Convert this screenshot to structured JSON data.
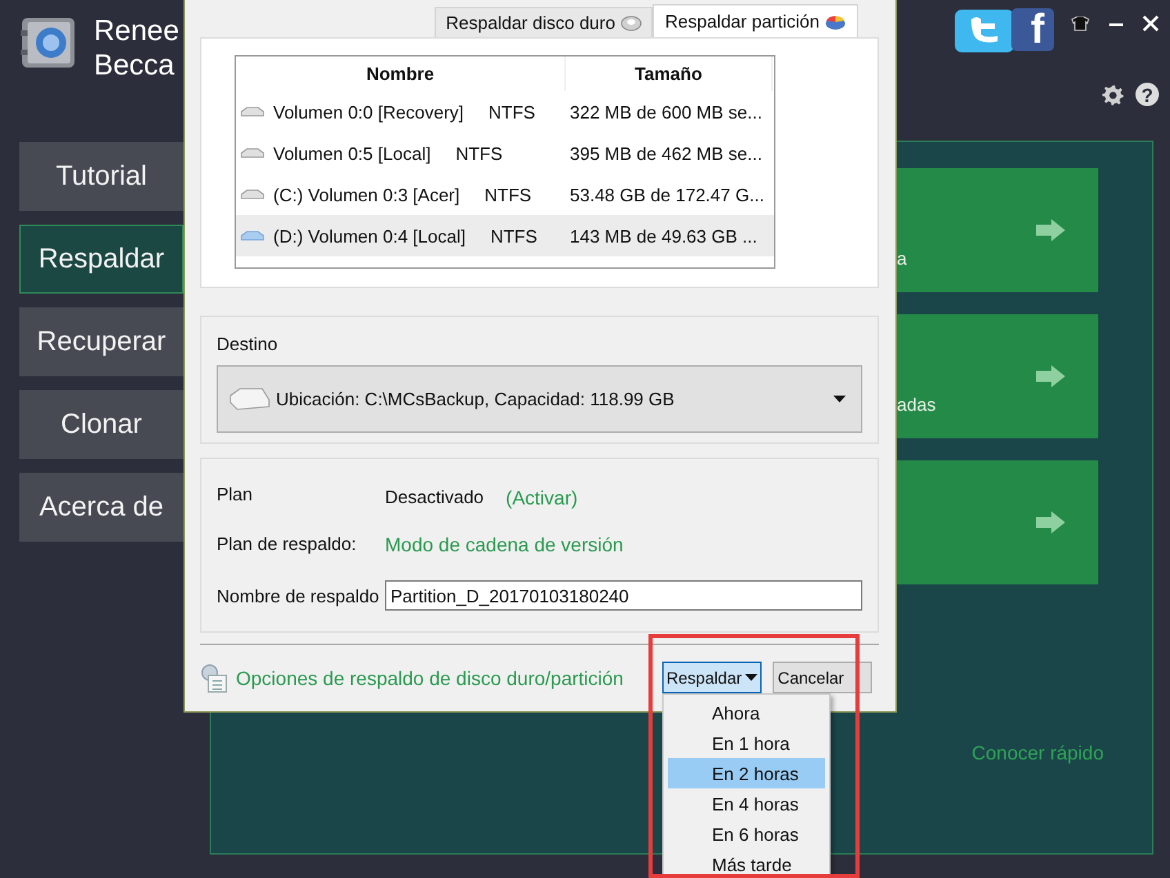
{
  "app": {
    "app_name": "Renee Becca",
    "social": {
      "facebook_glyph": "f"
    },
    "help_glyph": "?",
    "nav": [
      {
        "label": "Tutorial",
        "selected": false
      },
      {
        "label": "Respaldar",
        "selected": true
      },
      {
        "label": "Recuperar",
        "selected": false
      },
      {
        "label": "Clonar",
        "selected": false
      },
      {
        "label": "Acerca de",
        "selected": false
      }
    ],
    "card_captions": [
      "a",
      "adas"
    ],
    "quick_link": "Conocer rápido"
  },
  "dialog": {
    "tabs": [
      {
        "label": "Respaldar disco duro",
        "selected": false
      },
      {
        "label": "Respaldar partición",
        "selected": true
      }
    ],
    "table": {
      "columns": [
        "Nombre",
        "Tamaño"
      ],
      "rows": [
        {
          "name": "Volumen 0:0 [Recovery]",
          "file_system": "NTFS",
          "size": "322 MB de 600 MB se...",
          "selected": false
        },
        {
          "name": "Volumen 0:5 [Local]",
          "file_system": "NTFS",
          "size": "395 MB de 462 MB se...",
          "selected": false
        },
        {
          "name": "(C:) Volumen 0:3 [Acer]",
          "file_system": "NTFS",
          "size": "53.48 GB de 172.47 G...",
          "selected": false
        },
        {
          "name": "(D:) Volumen 0:4 [Local]",
          "file_system": "NTFS",
          "size": "143 MB de 49.63 GB ...",
          "selected": true
        }
      ]
    },
    "destination": {
      "label": "Destino",
      "value": "Ubicación: C:\\MCsBackup, Capacidad: 118.99 GB"
    },
    "plan": {
      "label": "Plan",
      "status": "Desactivado",
      "link": "(Activar)"
    },
    "scheme": {
      "label": "Plan de respaldo:",
      "value": "Modo de cadena de versión"
    },
    "backup_name": {
      "label": "Nombre de respaldo",
      "value": "Partition_D_20170103180240"
    },
    "options_link": "Opciones de respaldo de disco duro/partición",
    "buttons": [
      {
        "label": "Respaldar",
        "kind": "split"
      },
      {
        "label": "Cancelar",
        "kind": "plain"
      }
    ],
    "menu": [
      {
        "label": "Ahora",
        "selected": false
      },
      {
        "label": "En 1 hora",
        "selected": false
      },
      {
        "label": "En 2 horas",
        "selected": true
      },
      {
        "label": "En 4 horas",
        "selected": false
      },
      {
        "label": "En 6 horas",
        "selected": false
      },
      {
        "label": "Más tarde",
        "selected": false
      }
    ]
  }
}
